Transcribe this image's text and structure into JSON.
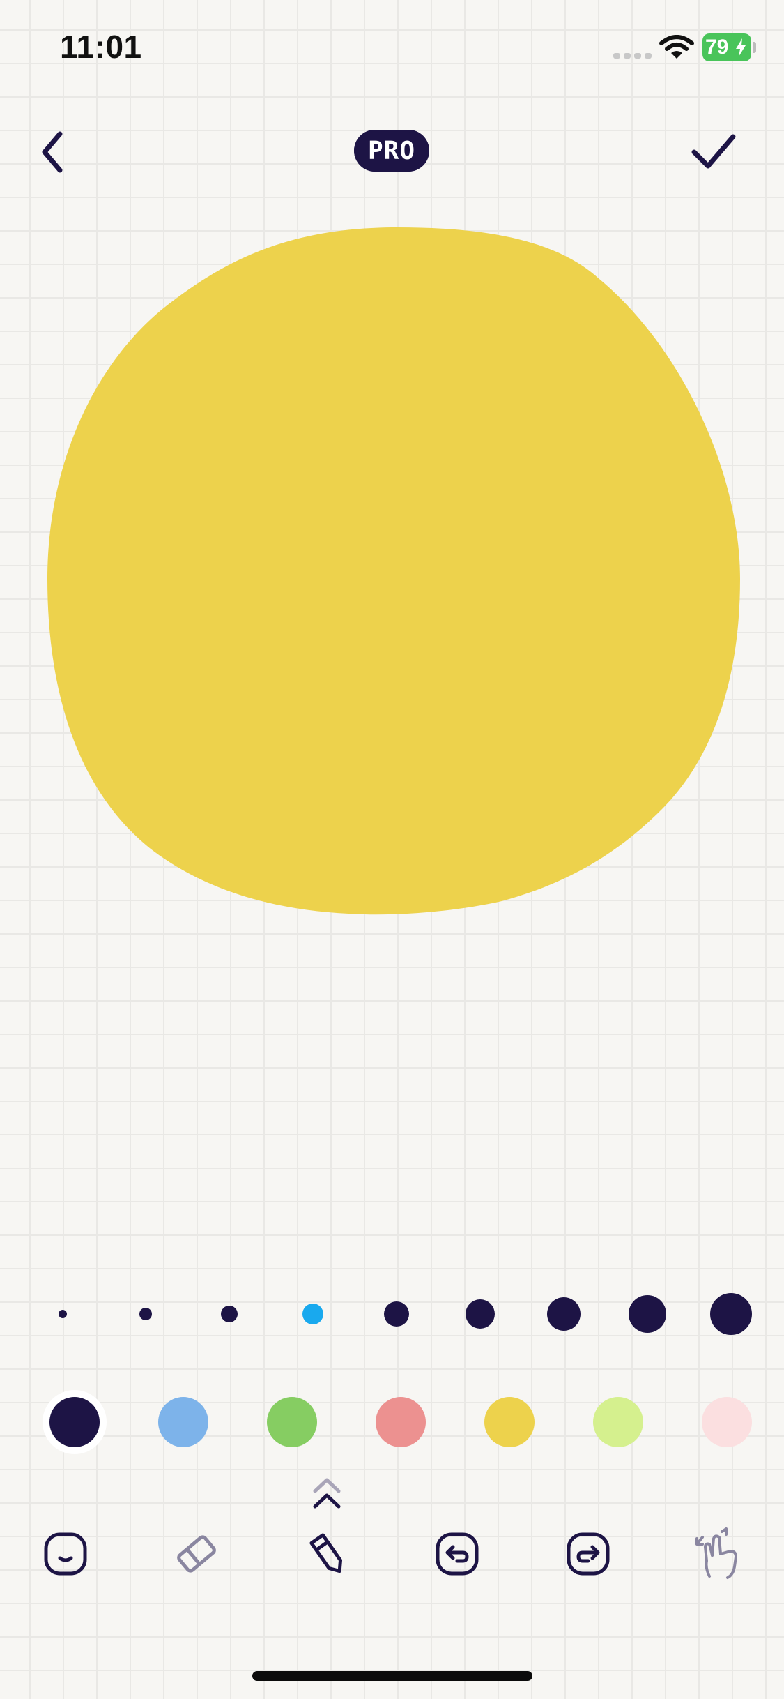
{
  "status_bar": {
    "time": "11:01",
    "battery_level": "79",
    "signal_icon": "cellular-signal-icon",
    "wifi_icon": "wifi-icon",
    "battery_color": "#49c45a"
  },
  "header": {
    "back_icon": "chevron-left-icon",
    "badge_label": "PRO",
    "done_icon": "checkmark-icon"
  },
  "canvas": {
    "shape": "blob",
    "fill_color": "#edd24c"
  },
  "brush_sizes": {
    "count": 9,
    "selected_index": 3,
    "selected_color": "#19a9ee",
    "default_color": "#1d1445"
  },
  "palette": {
    "selected_index": 0,
    "colors": [
      "#1d1445",
      "#7db3ea",
      "#86cd62",
      "#ec9190",
      "#edd24c",
      "#d5f08e",
      "#fbdfe0"
    ]
  },
  "toolbar": {
    "expand_icon": "chevron-up-icon",
    "tools": [
      {
        "name": "sticker",
        "icon": "smiley-face-icon",
        "active": false
      },
      {
        "name": "eraser",
        "icon": "eraser-icon",
        "active": false
      },
      {
        "name": "pencil",
        "icon": "pencil-icon",
        "active": true
      },
      {
        "name": "undo",
        "icon": "undo-icon",
        "active": false
      },
      {
        "name": "redo",
        "icon": "redo-icon",
        "active": false
      },
      {
        "name": "pinch-zoom",
        "icon": "pinch-gesture-icon",
        "active": false
      }
    ]
  }
}
